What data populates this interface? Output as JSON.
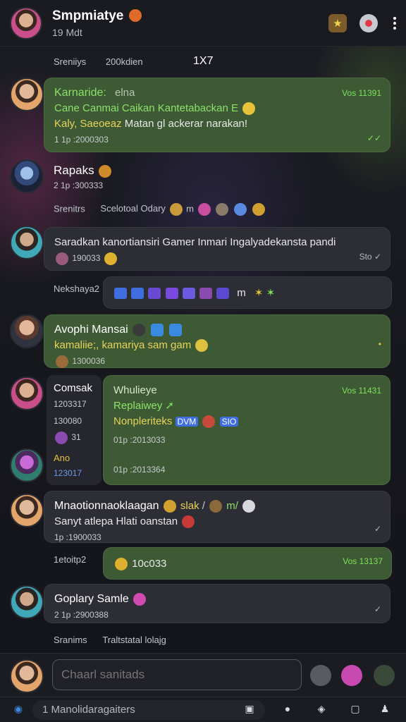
{
  "header": {
    "title": "Smpmiatye",
    "subtitle": "19 Mdt",
    "icons": [
      "trophy-icon",
      "record-icon",
      "more-vertical-icon"
    ]
  },
  "system_lines": [
    {
      "left": "Sreniiys",
      "mid": "200kdien",
      "right": "1X7"
    },
    {
      "left": "Srenitrs",
      "mid": "Scelotoal Odary",
      "tail": "m"
    },
    {
      "left": "Nekshaya2",
      "tail": "m"
    },
    {
      "left": "1etoitp2"
    },
    {
      "left": "Sranims",
      "mid": "Traltstatal lolajg"
    }
  ],
  "messages": [
    {
      "sender": "Karnaride:",
      "sender_tag": "elna",
      "time": "Vos 11391",
      "line1": "Cane Canmai Caikan Kantetabackan E",
      "line2a": "Kaly, Saeoeaz",
      "line2b": "Matan gl ackerar narakan!",
      "meta": "1 1p :2000303"
    },
    {
      "sender": "Rapaks",
      "meta": "2 1p :300333"
    },
    {
      "text": "Saradkan kanortiansiri Gamer Inmari Ingalyadekansta pandi",
      "meta": "190033",
      "tick": "Sto"
    },
    {
      "sender": "Avophi Mansai",
      "text": "kamaliie;, kamariya sam gam",
      "meta": "1300036"
    },
    {
      "left_name": "Comsak",
      "left_time1": "1203317",
      "left_time2": "130080",
      "left_num": "31",
      "left_tag": "Ano",
      "left_time3": "123017",
      "sender": "Whulieye",
      "time": "Vos 11431",
      "line1": "Replaiwey",
      "line2": "Nonpleriteks",
      "chip1": "DVM",
      "chip2": "SIO",
      "meta1": "01p :2013033",
      "meta2": "01p :2013364"
    },
    {
      "sender": "Mnaotionnaoklaagan",
      "sender_tag1": "slak",
      "sender_tag2": "m/",
      "text": "Sanyt atlepa Hlati oanstan",
      "meta": "1p :1900033"
    },
    {
      "text": "10c033",
      "time": "Vos 13137"
    },
    {
      "sender": "Goplary Samle",
      "meta": "2 1p :2900388"
    }
  ],
  "composer": {
    "placeholder": "Chaarl sanitads"
  },
  "navbar": {
    "field": "1 Manolidaragaiters"
  },
  "colors": {
    "green_bubble": "#3d5a35",
    "accent_green": "#7de25a",
    "dark_bubble": "#2d2e35"
  }
}
